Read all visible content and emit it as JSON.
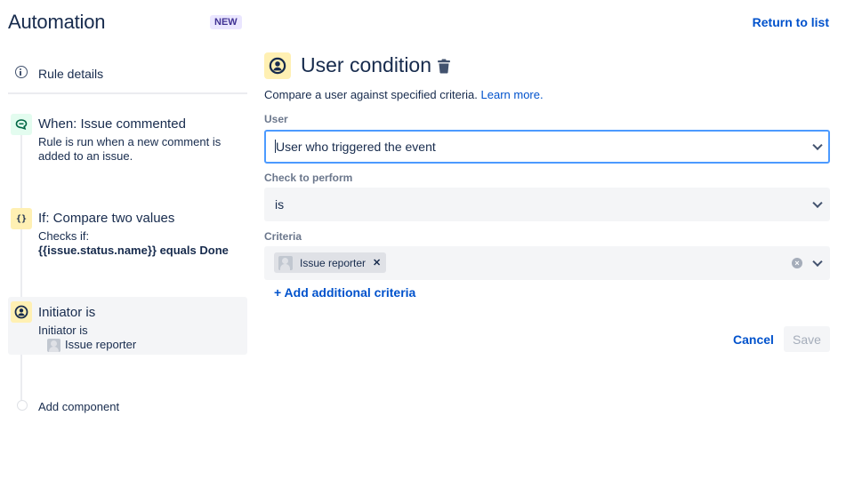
{
  "header": {
    "title": "Automation",
    "badge": "NEW",
    "return_link": "Return to list"
  },
  "sidebar": {
    "rule_details": "Rule details",
    "steps": [
      {
        "icon": "comment-icon",
        "title": "When: Issue commented",
        "description": "Rule is run when a new comment is added to an issue."
      },
      {
        "icon": "braces-icon",
        "icon_glyph": "{}",
        "title": "If: Compare two values",
        "description_prefix": "Checks if:",
        "description_bold": "{{issue.status.name}} equals Done"
      },
      {
        "icon": "user-icon",
        "title": "Initiator is",
        "description": "Initiator is",
        "value": "Issue reporter",
        "selected": true
      }
    ],
    "add_component": "Add component"
  },
  "panel": {
    "title": "User condition",
    "description": "Compare a user against specified criteria.",
    "learn_more": "Learn more.",
    "user_field": {
      "label": "User",
      "value": "User who triggered the event"
    },
    "check_field": {
      "label": "Check to perform",
      "value": "is"
    },
    "criteria_field": {
      "label": "Criteria",
      "chips": [
        "Issue reporter"
      ]
    },
    "add_criteria": "+ Add additional criteria",
    "cancel": "Cancel",
    "save": "Save"
  },
  "colors": {
    "link": "#0052cc",
    "focus_border": "#4c9aff",
    "badge_bg": "#eae6ff",
    "badge_text": "#403294",
    "trigger_icon_bg": "#e3fcef",
    "condition_icon_bg": "#fff0b3"
  }
}
